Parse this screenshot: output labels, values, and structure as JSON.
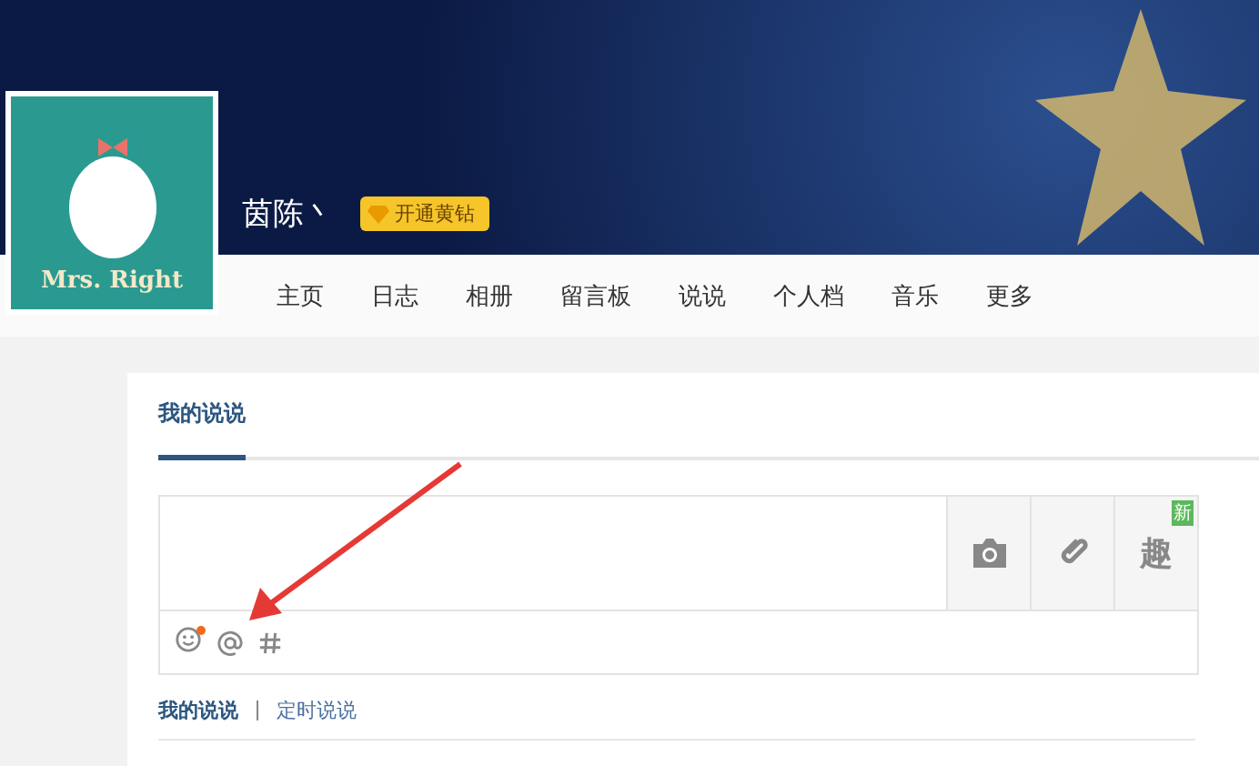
{
  "profile": {
    "avatar_text": "Mrs. Right",
    "name": "茵陈丶",
    "vip_badge": "开通黄钻"
  },
  "nav": [
    {
      "label": "主页"
    },
    {
      "label": "日志"
    },
    {
      "label": "相册"
    },
    {
      "label": "留言板"
    },
    {
      "label": "说说"
    },
    {
      "label": "个人档"
    },
    {
      "label": "音乐"
    },
    {
      "label": "更多"
    }
  ],
  "tabs": [
    {
      "label": "我的说说",
      "selected": true
    }
  ],
  "composer": {
    "fun_label": "趣",
    "new_badge": "新",
    "emoji_notice": true
  },
  "subtabs": [
    {
      "label": "我的说说",
      "selected": true
    },
    {
      "label": "定时说说",
      "selected": false
    }
  ]
}
